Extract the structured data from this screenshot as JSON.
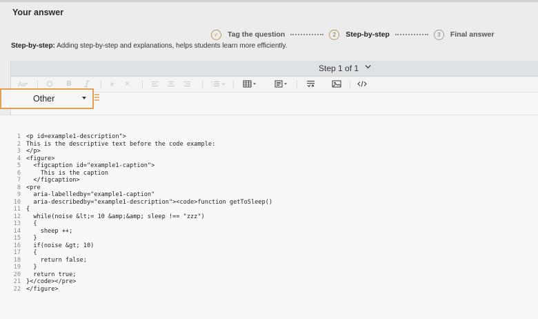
{
  "title": "Your answer",
  "stepper": {
    "steps": [
      {
        "label": "Tag the question",
        "marker": "✓",
        "state": "done"
      },
      {
        "label": "Step-by-step",
        "marker": "2",
        "state": "active"
      },
      {
        "label": "Final answer",
        "marker": "3",
        "state": "todo"
      }
    ]
  },
  "help": {
    "label": "Step-by-step:",
    "text": "Adding step-by-step and explanations, helps students learn more efficiently."
  },
  "step_header": {
    "label": "Step 1 of 1"
  },
  "toolbar": {
    "font_size_label": "Aa",
    "bold_label": "B",
    "items": [
      "font-size-icon",
      "bold-icon",
      "italic-icon",
      "align-left-icon",
      "align-center-icon",
      "align-right-icon",
      "list-icon",
      "table-icon",
      "code-block-icon",
      "equation-icon",
      "image-icon",
      "code-icon"
    ]
  },
  "language_select": {
    "value": "Other"
  },
  "code": {
    "lines": [
      {
        "n": "1",
        "text": "<p id=example1-description\">"
      },
      {
        "n": "2",
        "text": "This is the descriptive text before the code example:"
      },
      {
        "n": "3",
        "text": "</p>"
      },
      {
        "n": "4",
        "text": "<figure>"
      },
      {
        "n": "5",
        "text": "  <figcaption id=\"example1-caption\">"
      },
      {
        "n": "6",
        "text": "    This is the caption"
      },
      {
        "n": "7",
        "text": "  </figcaption>"
      },
      {
        "n": "8",
        "text": "<pre"
      },
      {
        "n": "9",
        "text": "  aria-labelledby=\"example1-caption\""
      },
      {
        "n": "10",
        "text": "  aria-describedby=\"example1-description\"><code>function getToSleep()"
      },
      {
        "n": "11",
        "text": "{"
      },
      {
        "n": "12",
        "text": "  while(noise &lt;= 10 &amp;&amp; sleep !== \"zzz\")"
      },
      {
        "n": "13",
        "text": "  {"
      },
      {
        "n": "14",
        "text": "    sheep ++;"
      },
      {
        "n": "15",
        "text": "  }"
      },
      {
        "n": "16",
        "text": "  if(noise &gt; 10)"
      },
      {
        "n": "17",
        "text": "  {"
      },
      {
        "n": "18",
        "text": "    return false;"
      },
      {
        "n": "19",
        "text": "  }"
      },
      {
        "n": "20",
        "text": "  return true;"
      },
      {
        "n": "21",
        "text": "}</code></pre>"
      },
      {
        "n": "22",
        "text": "</figure>"
      }
    ]
  },
  "colors": {
    "accent": "#e0a052",
    "step": "#b69a55"
  }
}
